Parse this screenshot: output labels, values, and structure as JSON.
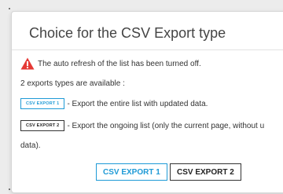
{
  "dialog": {
    "title": "Choice for the CSV Export type",
    "warning_text": "The auto refresh of the list has been turned off.",
    "types_available": "2 exports types are available :",
    "option1": {
      "badge": "CSV EXPORT 1",
      "description": "- Export the entire list with updated data."
    },
    "option2": {
      "badge": "CSV EXPORT 2",
      "description": "- Export the ongoing list (only the current page, without u",
      "continuation": "data)."
    },
    "buttons": {
      "export1": "CSV EXPORT 1",
      "export2": "CSV EXPORT 2"
    }
  },
  "colors": {
    "accent": "#1e9ad6",
    "warning": "#e53935"
  },
  "icons": {
    "warning": "warning-triangle-icon"
  }
}
